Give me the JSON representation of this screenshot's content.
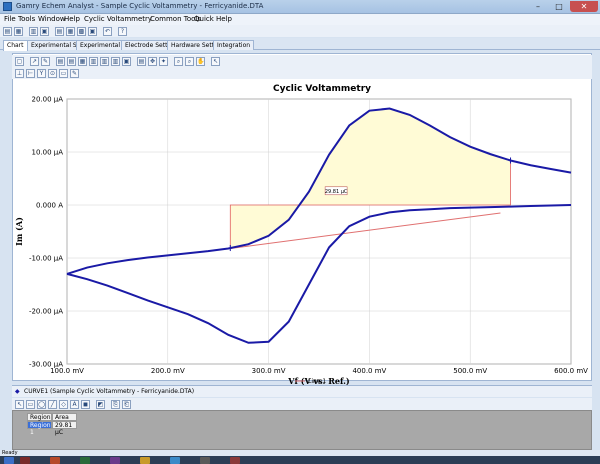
{
  "window": {
    "title": "Gamry Echem Analyst - Sample Cyclic Voltammetry - Ferricyanide.DTA",
    "min": "–",
    "max": "□",
    "close": "✕"
  },
  "menu": {
    "items": [
      "File",
      "Tools",
      "Window",
      "Help",
      "Cyclic Voltammetry",
      "Common Tools",
      "Quick Help"
    ]
  },
  "tabs": [
    "Chart",
    "Experimental Setup",
    "Experimental Notes",
    "Electrode Settings",
    "Hardware Settings",
    "Integration"
  ],
  "chart_data": {
    "type": "line",
    "title": "Cyclic Voltammetry",
    "xlabel": "Vf (V vs. Ref.)",
    "ylabel": "Im (A)",
    "xlim": [
      100,
      600
    ],
    "ylim": [
      -30,
      20
    ],
    "x_ticks": [
      "100.0 mV",
      "200.0 mV",
      "300.0 mV",
      "400.0 mV",
      "500.0 mV",
      "600.0 mV"
    ],
    "x_tick_values": [
      100,
      200,
      300,
      400,
      500,
      600
    ],
    "y_ticks": [
      "20.00 µA",
      "10.00 µA",
      "0.000 A",
      "-10.00 µA",
      "-20.00 µA",
      "-30.00 µA"
    ],
    "y_tick_values": [
      20,
      10,
      0,
      -10,
      -20,
      -30
    ],
    "grid": true,
    "series": [
      {
        "name": "CURVE1 (Sample Cyclic Voltammetry - Ferricyanide.DTA)",
        "color": "#1a1aa6",
        "forward": {
          "x": [
            100,
            120,
            140,
            160,
            180,
            200,
            220,
            240,
            260,
            280,
            300,
            320,
            340,
            360,
            380,
            400,
            420,
            440,
            460,
            480,
            500,
            520,
            540,
            560,
            580,
            600
          ],
          "y": [
            -13.0,
            -11.8,
            -11.0,
            -10.4,
            -9.9,
            -9.5,
            -9.1,
            -8.7,
            -8.2,
            -7.4,
            -5.8,
            -2.8,
            2.5,
            9.5,
            15.0,
            17.8,
            18.2,
            17.0,
            15.0,
            12.8,
            11.0,
            9.6,
            8.4,
            7.5,
            6.8,
            6.1
          ]
        },
        "reverse": {
          "x": [
            600,
            580,
            560,
            540,
            520,
            500,
            480,
            460,
            440,
            420,
            400,
            380,
            360,
            340,
            320,
            300,
            280,
            260,
            240,
            220,
            200,
            180,
            160,
            140,
            120,
            100
          ],
          "y": [
            0.0,
            -0.1,
            -0.2,
            -0.3,
            -0.4,
            -0.5,
            -0.6,
            -0.8,
            -1.0,
            -1.4,
            -2.2,
            -4.0,
            -8.0,
            -15.0,
            -22.0,
            -25.8,
            -26.0,
            -24.5,
            -22.3,
            -20.6,
            -19.3,
            -18.0,
            -16.6,
            -15.2,
            -14.0,
            -13.0
          ]
        }
      },
      {
        "name": "Line 1",
        "color": "#e07070",
        "x": [
          262,
          530
        ],
        "y": [
          -8.2,
          -1.5
        ]
      }
    ],
    "integration": {
      "x_start": 262,
      "x_end": 540,
      "label": "29.81 µC"
    }
  },
  "chart": {
    "legend_line1": "Line 1"
  },
  "bottom": {
    "curve_label": "CURVE1 (Sample Cyclic Voltammetry - Ferricyanide.DTA)",
    "table_headers": [
      "Region",
      "Area"
    ],
    "table_row": [
      "Region 1",
      "29.81 µC"
    ]
  },
  "status": {
    "text": "Ready"
  }
}
